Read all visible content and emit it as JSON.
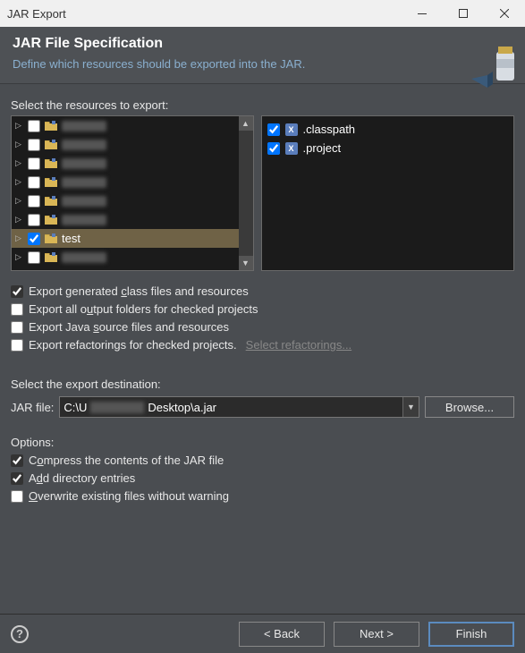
{
  "titlebar": {
    "title": "JAR Export"
  },
  "header": {
    "title": "JAR File Specification",
    "subtitle": "Define which resources should be exported into the JAR."
  },
  "resources_label": "Select the resources to export:",
  "tree_items": [
    {
      "label": "",
      "blurred": true,
      "checked": false,
      "selected": false
    },
    {
      "label": "",
      "blurred": true,
      "checked": false,
      "selected": false
    },
    {
      "label": "",
      "blurred": true,
      "checked": false,
      "selected": false
    },
    {
      "label": "",
      "blurred": true,
      "checked": false,
      "selected": false
    },
    {
      "label": "",
      "blurred": true,
      "checked": false,
      "selected": false
    },
    {
      "label": "",
      "blurred": true,
      "checked": false,
      "selected": false
    },
    {
      "label": "test",
      "blurred": false,
      "checked": true,
      "selected": true
    },
    {
      "label": "",
      "blurred": true,
      "checked": false,
      "selected": false
    }
  ],
  "file_items": [
    {
      "label": ".classpath",
      "checked": true
    },
    {
      "label": ".project",
      "checked": true
    }
  ],
  "export_opts": {
    "class_files": {
      "label_pre": "Export generated ",
      "u": "c",
      "label_post": "lass files and resources",
      "checked": true
    },
    "output_folders": {
      "label_pre": "Export all o",
      "u": "u",
      "label_post": "tput folders for checked projects",
      "checked": false
    },
    "java_source": {
      "label_pre": "Export Java ",
      "u": "s",
      "label_post": "ource files and resources",
      "checked": false
    },
    "refactorings": {
      "label_pre": "Export refactorings for checked projects.",
      "link": "Select refactorings...",
      "checked": false
    }
  },
  "dest_label": "Select the export destination:",
  "jar_file": {
    "label": "JAR file:",
    "pre": "C:\\U",
    "post": "Desktop\\a.jar",
    "browse": "Browse..."
  },
  "options_label": "Options:",
  "options": {
    "compress": {
      "label_pre": "C",
      "u": "o",
      "label_post": "mpress the contents of the JAR file",
      "checked": true
    },
    "dir_entries": {
      "label_pre": "A",
      "u": "d",
      "label_post": "d directory entries",
      "checked": true
    },
    "overwrite": {
      "label_pre": "",
      "u": "O",
      "label_post": "verwrite existing files without warning",
      "checked": false
    }
  },
  "buttons": {
    "back": "< Back",
    "next": "Next >",
    "finish": "Finish"
  }
}
